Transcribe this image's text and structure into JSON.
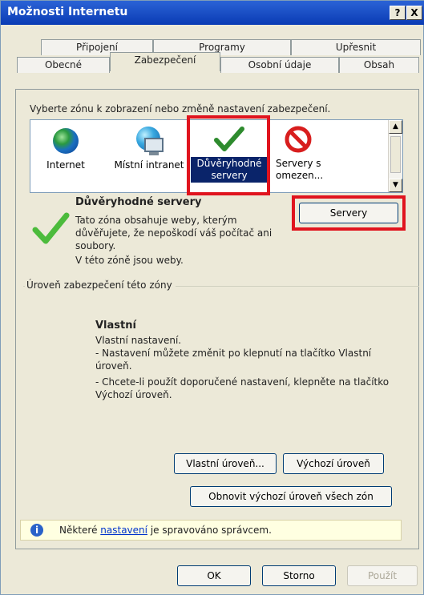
{
  "window": {
    "title": "Možnosti Internetu",
    "help_label": "?",
    "close_label": "X"
  },
  "tabs": {
    "row1": [
      "Připojení",
      "Programy",
      "Upřesnit"
    ],
    "row2": [
      "Obecné",
      "Zabezpečení",
      "Osobní údaje",
      "Obsah"
    ],
    "active": "Zabezpečení"
  },
  "instruction": "Vyberte zónu k zobrazení nebo změně nastavení zabezpečení.",
  "zones": [
    {
      "label": "Internet",
      "icon": "globe-icon",
      "selected": false
    },
    {
      "label": "Místní intranet",
      "icon": "globe-computer-icon",
      "selected": false
    },
    {
      "label": "Důvěryhodné servery",
      "icon": "checkmark-icon",
      "selected": true
    },
    {
      "label": "Servery s omezen...",
      "icon": "no-entry-icon",
      "selected": false
    }
  ],
  "zone_info": {
    "title": "Důvěryhodné servery",
    "description": "Tato zóna obsahuje weby, kterým důvěřujete, že nepoškodí váš počítač ani soubory.",
    "status": "V této zóně jsou weby.",
    "servers_button": "Servery"
  },
  "security_level": {
    "group_label": "Úroveň zabezpečení této zóny",
    "level_title": "Vlastní",
    "details": [
      "Vlastní nastavení.",
      "- Nastavení můžete změnit po klepnutí na tlačítko Vlastní úroveň.",
      "- Chcete-li použít doporučené nastavení, klepněte na tlačítko Výchozí úroveň."
    ],
    "custom_button": "Vlastní úroveň...",
    "default_button": "Výchozí úroveň",
    "reset_all_button": "Obnovit výchozí úroveň všech zón"
  },
  "notice": {
    "prefix": "Některé",
    "link": "nastavení",
    "suffix": "je spravováno správcem."
  },
  "footer": {
    "ok": "OK",
    "cancel": "Storno",
    "apply": "Použít"
  },
  "colors": {
    "highlight": "#e0141e",
    "selection": "#0a246a",
    "titlebar": "#0a3bb4"
  }
}
